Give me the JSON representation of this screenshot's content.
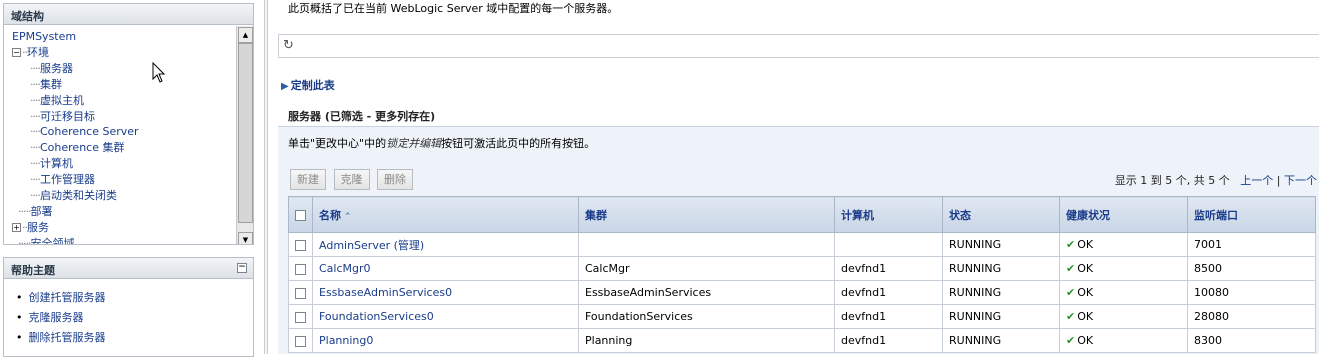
{
  "left": {
    "domain_panel": {
      "title": "域结构",
      "tree": [
        {
          "label": "EPMSystem",
          "level": 0,
          "expander": ""
        },
        {
          "label": "环境",
          "level": 0,
          "expander": "−"
        },
        {
          "label": "服务器",
          "level": 2,
          "expander": ""
        },
        {
          "label": "集群",
          "level": 2,
          "expander": ""
        },
        {
          "label": "虚拟主机",
          "level": 2,
          "expander": ""
        },
        {
          "label": "可迁移目标",
          "level": 2,
          "expander": ""
        },
        {
          "label": "Coherence Server",
          "level": 2,
          "expander": ""
        },
        {
          "label": "Coherence 集群",
          "level": 2,
          "expander": ""
        },
        {
          "label": "计算机",
          "level": 2,
          "expander": ""
        },
        {
          "label": "工作管理器",
          "level": 2,
          "expander": ""
        },
        {
          "label": "启动类和关闭类",
          "level": 2,
          "expander": ""
        },
        {
          "label": "部署",
          "level": 1,
          "expander": ""
        },
        {
          "label": "服务",
          "level": 0,
          "expander": "+"
        },
        {
          "label": "安全领域",
          "level": 1,
          "expander": ""
        }
      ],
      "scroll_up": "▲",
      "scroll_down": "▼"
    },
    "help_panel": {
      "title": "帮助主题",
      "collapse": "−",
      "items": [
        "创建托管服务器",
        "克隆服务器",
        "删除托管服务器"
      ]
    }
  },
  "main": {
    "intro": "此页概括了已在当前 WebLogic Server 域中配置的每一个服务器。",
    "refresh_icon": "↻",
    "customize": "定制此表",
    "customize_icon": "▶",
    "table_title": "服务器 (已筛选 - 更多列存在)",
    "message_pre": "单击\"更改中心\"中的",
    "message_em": "锁定并编辑",
    "message_post": "按钮可激活此页中的所有按钮。",
    "buttons": {
      "new": "新建",
      "clone": "克隆",
      "delete": "删除"
    },
    "pager": {
      "summary": "显示 1 到 5 个, 共 5 个",
      "prev": "上一个",
      "sep": "|",
      "next": "下一个"
    },
    "columns": [
      "名称",
      "集群",
      "计算机",
      "状态",
      "健康状况",
      "监听端口"
    ],
    "sort_indicator": "⌃",
    "ok_icon": "✔",
    "rows": [
      {
        "name": "AdminServer (管理)",
        "cluster": "",
        "machine": "",
        "state": "RUNNING",
        "health": "OK",
        "port": "7001"
      },
      {
        "name": "CalcMgr0",
        "cluster": "CalcMgr",
        "machine": "devfnd1",
        "state": "RUNNING",
        "health": "OK",
        "port": "8500"
      },
      {
        "name": "EssbaseAdminServices0",
        "cluster": "EssbaseAdminServices",
        "machine": "devfnd1",
        "state": "RUNNING",
        "health": "OK",
        "port": "10080"
      },
      {
        "name": "FoundationServices0",
        "cluster": "FoundationServices",
        "machine": "devfnd1",
        "state": "RUNNING",
        "health": "OK",
        "port": "28080"
      },
      {
        "name": "Planning0",
        "cluster": "Planning",
        "machine": "devfnd1",
        "state": "RUNNING",
        "health": "OK",
        "port": "8300"
      }
    ]
  }
}
